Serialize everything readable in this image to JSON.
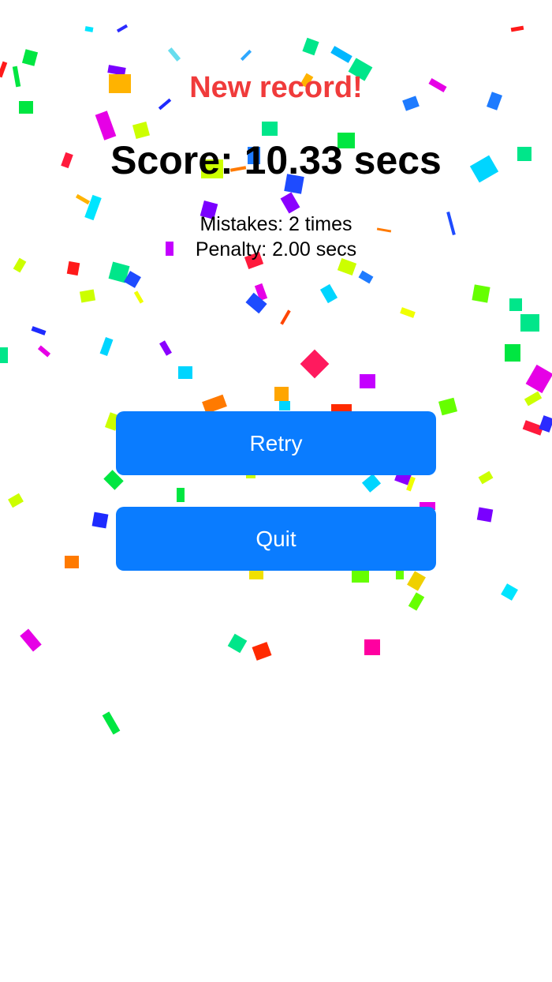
{
  "result": {
    "record_label": "New record!",
    "score_text": "Score: 10.33 secs",
    "mistakes_text": "Mistakes: 2 times",
    "penalty_text": "Penalty: 2.00 secs"
  },
  "actions": {
    "retry_label": "Retry",
    "quit_label": "Quit"
  },
  "colors": {
    "record": "#f03b3b",
    "button": "#0a7cff",
    "button_text": "#ffffff"
  }
}
